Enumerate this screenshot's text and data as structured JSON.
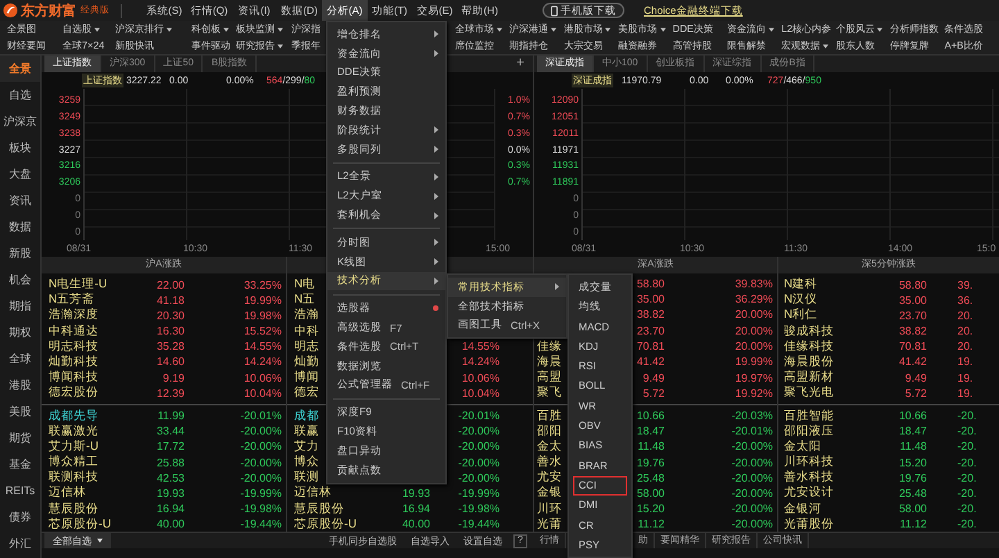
{
  "app": {
    "logo_text": "东方财富",
    "edition": "经典版"
  },
  "menu_bar": [
    {
      "label": "系统(S)",
      "selected": false
    },
    {
      "label": "行情(Q)",
      "selected": false
    },
    {
      "label": "资讯(I)",
      "selected": false
    },
    {
      "label": "数据(D)",
      "selected": false
    },
    {
      "label": "分析(A)",
      "selected": true
    },
    {
      "label": "功能(T)",
      "selected": false
    },
    {
      "label": "交易(E)",
      "selected": false
    },
    {
      "label": "帮助(H)",
      "selected": false
    }
  ],
  "downloads": {
    "mobile": "手机版下载",
    "choice": "Choice金融终端下载"
  },
  "toolbar": {
    "left_rows": [
      [
        {
          "label": "全景图",
          "dropdown": false
        },
        {
          "label": "自选股",
          "dropdown": true
        },
        {
          "label": "沪深京排行",
          "dropdown": true
        },
        {
          "label": "科创板",
          "dropdown": true
        },
        {
          "label": "板块监测",
          "dropdown": true
        },
        {
          "label": "沪深指",
          "dropdown": false
        }
      ],
      [
        {
          "label": "财经要闻",
          "dropdown": false
        },
        {
          "label": "全球7×24",
          "dropdown": false
        },
        {
          "label": "新股快讯",
          "dropdown": false
        },
        {
          "label": "事件驱动",
          "dropdown": false
        },
        {
          "label": "研究报告",
          "dropdown": true
        },
        {
          "label": "季报年",
          "dropdown": false
        }
      ]
    ],
    "right_rows": [
      [
        {
          "label": "全球市场",
          "dropdown": true
        },
        {
          "label": "沪深港通",
          "dropdown": true
        },
        {
          "label": "港股市场",
          "dropdown": true
        },
        {
          "label": "美股市场",
          "dropdown": true
        },
        {
          "label": "DDE决策",
          "dropdown": false
        },
        {
          "label": "资金流向",
          "dropdown": true
        },
        {
          "label": "L2核心内参",
          "dropdown": false
        },
        {
          "label": "个股风云",
          "dropdown": true
        },
        {
          "label": "分析师指数",
          "dropdown": false
        },
        {
          "label": "条件选股",
          "dropdown": false
        }
      ],
      [
        {
          "label": "席位监控",
          "dropdown": false
        },
        {
          "label": "期指持仓",
          "dropdown": false
        },
        {
          "label": "大宗交易",
          "dropdown": false
        },
        {
          "label": "融资融券",
          "dropdown": false
        },
        {
          "label": "高管持股",
          "dropdown": false
        },
        {
          "label": "限售解禁",
          "dropdown": false
        },
        {
          "label": "宏观数据",
          "dropdown": true
        },
        {
          "label": "股东人数",
          "dropdown": false
        },
        {
          "label": "停牌复牌",
          "dropdown": false
        },
        {
          "label": "A+B比价",
          "dropdown": false
        }
      ]
    ]
  },
  "sidebar": [
    {
      "label": "全景",
      "selected": true
    },
    {
      "label": "自选",
      "selected": false
    },
    {
      "label": "沪深京",
      "selected": false
    },
    {
      "label": "板块",
      "selected": false
    },
    {
      "label": "大盘",
      "selected": false
    },
    {
      "label": "资讯",
      "selected": false
    },
    {
      "label": "数据",
      "selected": false
    },
    {
      "label": "新股",
      "selected": false
    },
    {
      "label": "机会",
      "selected": false
    },
    {
      "label": "期指",
      "selected": false
    },
    {
      "label": "期权",
      "selected": false
    },
    {
      "label": "全球",
      "selected": false
    },
    {
      "label": "港股",
      "selected": false
    },
    {
      "label": "美股",
      "selected": false
    },
    {
      "label": "期货",
      "selected": false
    },
    {
      "label": "基金",
      "selected": false
    },
    {
      "label": "REITs",
      "selected": false
    },
    {
      "label": "债券",
      "selected": false
    },
    {
      "label": "外汇",
      "selected": false
    }
  ],
  "charts": [
    {
      "tabs": [
        {
          "label": "上证指数",
          "selected": true
        },
        {
          "label": "沪深300",
          "selected": false
        },
        {
          "label": "上证50",
          "selected": false
        },
        {
          "label": "B股指数",
          "selected": false
        }
      ],
      "add_label": "+",
      "info": {
        "name": "上证指数",
        "value": "3227.22",
        "change": "0.00",
        "percent": "0.00%",
        "up_count": "564",
        "flat_count": "299",
        "down_count": "80",
        "count_separator": "/"
      },
      "y_labels": [
        {
          "text": "3259",
          "color": "#ef4b56"
        },
        {
          "text": "3249",
          "color": "#ef4b56"
        },
        {
          "text": "3238",
          "color": "#ef4b56"
        },
        {
          "text": "3227",
          "color": "#dddddd"
        },
        {
          "text": "3216",
          "color": "#2ec85a"
        },
        {
          "text": "3206",
          "color": "#2ec85a"
        },
        {
          "text": "0",
          "color": "#777777"
        },
        {
          "text": "0",
          "color": "#777777"
        },
        {
          "text": "0",
          "color": "#777777"
        }
      ],
      "pct_labels": [
        {
          "text": "1.0%",
          "color": "#ef4b56"
        },
        {
          "text": "0.7%",
          "color": "#ef4b56"
        },
        {
          "text": "0.3%",
          "color": "#ef4b56"
        },
        {
          "text": "0.0%",
          "color": "#dddddd"
        },
        {
          "text": "0.3%",
          "color": "#2ec85a"
        },
        {
          "text": "0.7%",
          "color": "#2ec85a"
        }
      ],
      "x_labels": [
        "08/31",
        "10:30",
        "11:30",
        "15:00"
      ]
    },
    {
      "tabs": [
        {
          "label": "深证成指",
          "selected": true
        },
        {
          "label": "中小100",
          "selected": false
        },
        {
          "label": "创业板指",
          "selected": false
        },
        {
          "label": "深证综指",
          "selected": false
        },
        {
          "label": "成份B指",
          "selected": false
        }
      ],
      "info": {
        "name": "深证成指",
        "value": "11970.79",
        "change": "0.00",
        "percent": "0.00%",
        "up_count": "727",
        "flat_count": "466",
        "down_count": "950",
        "count_separator": "/"
      },
      "y_labels": [
        {
          "text": "12090",
          "color": "#ef4b56"
        },
        {
          "text": "12051",
          "color": "#ef4b56"
        },
        {
          "text": "12011",
          "color": "#ef4b56"
        },
        {
          "text": "11971",
          "color": "#dddddd"
        },
        {
          "text": "11931",
          "color": "#2ec85a"
        },
        {
          "text": "11891",
          "color": "#2ec85a"
        },
        {
          "text": "0",
          "color": "#777777"
        },
        {
          "text": "0",
          "color": "#777777"
        },
        {
          "text": "0",
          "color": "#777777"
        }
      ],
      "x_labels": [
        "08/31",
        "10:30",
        "11:30",
        "14:00",
        "15:0"
      ]
    }
  ],
  "tables": [
    {
      "title": "沪A涨跌",
      "gainers": [
        {
          "name": "N电生理-U",
          "price": "22.00",
          "change": "33.25%",
          "highlighted": false
        },
        {
          "name": "N五芳斋",
          "price": "41.18",
          "change": "19.99%",
          "highlighted": false
        },
        {
          "name": "浩瀚深度",
          "price": "20.30",
          "change": "19.98%",
          "highlighted": false
        },
        {
          "name": "中科通达",
          "price": "16.30",
          "change": "15.52%",
          "highlighted": false
        },
        {
          "name": "明志科技",
          "price": "35.28",
          "change": "14.55%",
          "highlighted": false
        },
        {
          "name": "灿勤科技",
          "price": "14.60",
          "change": "14.24%",
          "highlighted": false
        },
        {
          "name": "博闻科技",
          "price": "9.19",
          "change": "10.06%",
          "highlighted": false
        },
        {
          "name": "德宏股份",
          "price": "12.39",
          "change": "10.04%",
          "highlighted": false
        }
      ],
      "losers": [
        {
          "name": "成都先导",
          "price": "11.99",
          "change": "-20.01%",
          "highlighted": true
        },
        {
          "name": "联赢激光",
          "price": "33.44",
          "change": "-20.00%",
          "highlighted": false
        },
        {
          "name": "艾力斯-U",
          "price": "17.72",
          "change": "-20.00%",
          "highlighted": false
        },
        {
          "name": "博众精工",
          "price": "25.88",
          "change": "-20.00%",
          "highlighted": false
        },
        {
          "name": "联测科技",
          "price": "42.53",
          "change": "-20.00%",
          "highlighted": false
        },
        {
          "name": "迈信林",
          "price": "19.93",
          "change": "-19.99%",
          "highlighted": false
        },
        {
          "name": "慧辰股份",
          "price": "16.94",
          "change": "-19.98%",
          "highlighted": false
        },
        {
          "name": "芯原股份-U",
          "price": "40.00",
          "change": "-19.44%",
          "highlighted": false
        }
      ]
    },
    {
      "gainers": [
        {
          "name": "N电",
          "highlighted": false
        },
        {
          "name": "N五",
          "highlighted": false
        },
        {
          "name": "浩瀚",
          "highlighted": false
        },
        {
          "name": "中科",
          "highlighted": false
        },
        {
          "name": "明志",
          "change": "14.55%",
          "highlighted": false
        },
        {
          "name": "灿勤",
          "change": "14.24%",
          "highlighted": false
        },
        {
          "name": "博闻",
          "change": "10.06%",
          "highlighted": false
        },
        {
          "name": "德宏",
          "change": "10.04%",
          "highlighted": false
        }
      ],
      "losers": [
        {
          "name": "成都",
          "change": "-20.01%",
          "highlighted": true
        },
        {
          "name": "联赢",
          "change": "-20.00%",
          "highlighted": false
        },
        {
          "name": "艾力",
          "change": "-20.00%",
          "highlighted": false
        },
        {
          "name": "博众",
          "change": "-20.00%",
          "highlighted": false
        },
        {
          "name": "联测",
          "change": "-20.00%",
          "highlighted": false
        },
        {
          "name": "迈信林",
          "price": "19.93",
          "change": "-19.99%",
          "highlighted": false
        },
        {
          "name": "慧辰股份",
          "price": "16.94",
          "change": "-19.98%",
          "highlighted": false
        },
        {
          "name": "芯原股份-U",
          "price": "40.00",
          "change": "-19.44%",
          "highlighted": false
        }
      ]
    },
    {
      "title": "深A涨跌",
      "gainers": [
        {
          "price": "58.80",
          "change": "39.83%"
        },
        {
          "price": "35.00",
          "change": "36.29%"
        },
        {
          "price": "38.82",
          "change": "20.00%"
        },
        {
          "price": "23.70",
          "change": "20.00%"
        },
        {
          "name": "佳缘",
          "price": "70.81",
          "change": "20.00%"
        },
        {
          "name": "海晨",
          "price": "41.42",
          "change": "19.99%"
        },
        {
          "name": "高盟",
          "price": "9.49",
          "change": "19.97%"
        },
        {
          "name": "聚飞",
          "price": "5.72",
          "change": "19.92%"
        }
      ],
      "losers": [
        {
          "name": "百胜",
          "price": "10.66",
          "change": "-20.03%"
        },
        {
          "name": "邵阳",
          "price": "18.47",
          "change": "-20.01%"
        },
        {
          "name": "金太",
          "price": "11.48",
          "change": "-20.00%"
        },
        {
          "name": "善水",
          "price": "19.76",
          "change": "-20.00%"
        },
        {
          "name": "尤安",
          "price": "25.48",
          "change": "-20.00%"
        },
        {
          "name": "金银",
          "price": "58.00",
          "change": "-20.00%"
        },
        {
          "name": "川环",
          "price": "15.20",
          "change": "-20.00%"
        },
        {
          "name": "光莆",
          "price": "11.12",
          "change": "-20.00%"
        }
      ]
    },
    {
      "title": "深5分钟涨跌",
      "gainers": [
        {
          "name": "N建科",
          "price": "58.80",
          "change": "39."
        },
        {
          "name": "N汉仪",
          "price": "35.00",
          "change": "36."
        },
        {
          "name": "N利仁",
          "price": "23.70",
          "change": "20."
        },
        {
          "name": "骏成科技",
          "price": "38.82",
          "change": "20."
        },
        {
          "name": "佳缘科技",
          "price": "70.81",
          "change": "20."
        },
        {
          "name": "海晨股份",
          "price": "41.42",
          "change": "19."
        },
        {
          "name": "高盟新材",
          "price": "9.49",
          "change": "19."
        },
        {
          "name": "聚飞光电",
          "price": "5.72",
          "change": "19."
        }
      ],
      "losers": [
        {
          "name": "百胜智能",
          "price": "10.66",
          "change": "-20."
        },
        {
          "name": "邵阳液压",
          "price": "18.47",
          "change": "-20."
        },
        {
          "name": "金太阳",
          "price": "11.48",
          "change": "-20."
        },
        {
          "name": "川环科技",
          "price": "15.20",
          "change": "-20."
        },
        {
          "name": "善水科技",
          "price": "19.76",
          "change": "-20."
        },
        {
          "name": "尤安设计",
          "price": "25.48",
          "change": "-20."
        },
        {
          "name": "金银河",
          "price": "58.00",
          "change": "-20."
        },
        {
          "name": "光莆股份",
          "price": "11.12",
          "change": "-20."
        }
      ]
    }
  ],
  "bottom_bar": {
    "watchlist_dropdown": "全部自选",
    "buttons": [
      "手机同步自选股",
      "自选导入",
      "设置自选",
      "?"
    ],
    "tabs": [
      "行情",
      "助",
      "要闻精华",
      "研究报告",
      "公司快讯"
    ]
  },
  "analysis_menu": [
    {
      "kind": "item",
      "label": "增仓排名",
      "submenu": true,
      "selected": false
    },
    {
      "kind": "item",
      "label": "资金流向",
      "submenu": true,
      "selected": false
    },
    {
      "kind": "item",
      "label": "DDE决策",
      "submenu": false,
      "selected": false
    },
    {
      "kind": "item",
      "label": "盈利预测",
      "submenu": false,
      "selected": false
    },
    {
      "kind": "item",
      "label": "财务数据",
      "submenu": false,
      "selected": false
    },
    {
      "kind": "item",
      "label": "阶段统计",
      "submenu": true,
      "selected": false
    },
    {
      "kind": "item",
      "label": "多股同列",
      "submenu": true,
      "selected": false
    },
    {
      "kind": "separator"
    },
    {
      "kind": "item",
      "label": "L2全景",
      "submenu": true,
      "selected": false
    },
    {
      "kind": "item",
      "label": "L2大户室",
      "submenu": true,
      "selected": false
    },
    {
      "kind": "item",
      "label": "套利机会",
      "submenu": true,
      "selected": false
    },
    {
      "kind": "separator"
    },
    {
      "kind": "item",
      "label": "分时图",
      "submenu": true,
      "selected": false
    },
    {
      "kind": "item",
      "label": "K线图",
      "submenu": true,
      "selected": false
    },
    {
      "kind": "item",
      "label": "技术分析",
      "submenu": true,
      "selected": true
    },
    {
      "kind": "separator"
    },
    {
      "kind": "flagged",
      "label": "选股器",
      "submenu": false,
      "selected": false
    },
    {
      "kind": "item",
      "label": "高级选股",
      "shortcut": "F7",
      "submenu": false,
      "selected": false
    },
    {
      "kind": "item",
      "label": "条件选股",
      "shortcut": "Ctrl+T",
      "submenu": false,
      "selected": false
    },
    {
      "kind": "item",
      "label": "数据浏览",
      "submenu": false,
      "selected": false
    },
    {
      "kind": "item",
      "label": "公式管理器",
      "shortcut": "Ctrl+F",
      "submenu": false,
      "selected": false
    },
    {
      "kind": "separator"
    },
    {
      "kind": "item",
      "label": "深度F9",
      "submenu": false,
      "selected": false
    },
    {
      "kind": "item",
      "label": "F10资料",
      "submenu": false,
      "selected": false
    },
    {
      "kind": "item",
      "label": "盘口异动",
      "submenu": false,
      "selected": false
    },
    {
      "kind": "item",
      "label": "贡献点数",
      "submenu": false,
      "selected": false
    }
  ],
  "technical_submenu": [
    {
      "kind": "item",
      "label": "常用技术指标",
      "submenu": true,
      "selected": true
    },
    {
      "kind": "item",
      "label": "全部技术指标",
      "submenu": false,
      "selected": false
    },
    {
      "kind": "item",
      "label": "画图工具",
      "shortcut": "Ctrl+X",
      "submenu": false,
      "selected": false
    }
  ],
  "indicator_submenu": [
    {
      "label": "成交量",
      "selected": false
    },
    {
      "label": "均线",
      "selected": false
    },
    {
      "label": "MACD",
      "selected": false
    },
    {
      "label": "KDJ",
      "selected": false
    },
    {
      "label": "RSI",
      "selected": false
    },
    {
      "label": "BOLL",
      "selected": false
    },
    {
      "label": "WR",
      "selected": false
    },
    {
      "label": "OBV",
      "selected": false
    },
    {
      "label": "BIAS",
      "selected": false
    },
    {
      "label": "BRAR",
      "selected": false
    },
    {
      "label": "CCI",
      "selected": true
    },
    {
      "label": "DMI",
      "selected": false
    },
    {
      "label": "CR",
      "selected": false
    },
    {
      "label": "PSY",
      "selected": false
    }
  ]
}
